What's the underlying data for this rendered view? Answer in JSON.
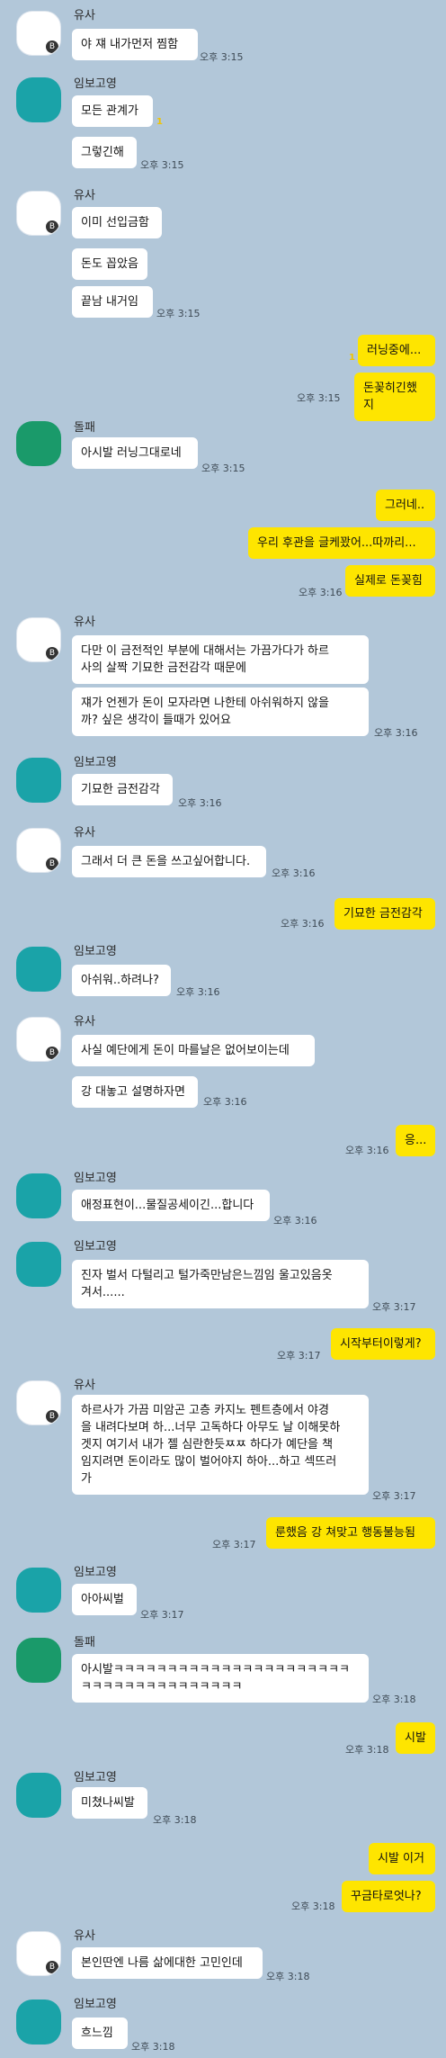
{
  "names": {
    "yusa": "유사",
    "boyoung": "임보고영",
    "dolpae": "돌패"
  },
  "messages": [
    {
      "text": "야 쟤 내가먼저 찜함",
      "time": "오후 3:15"
    },
    {
      "text": "모든 관계가",
      "time": ""
    },
    {
      "text": "그렇긴해",
      "time": "오후 3:15"
    },
    {
      "text": "이미 선입금함",
      "time": ""
    },
    {
      "text": "돈도 꼽았음",
      "time": ""
    },
    {
      "text": "끝남 내거임",
      "time": "오후 3:15"
    },
    {
      "text": "러닝중에...",
      "time": ""
    },
    {
      "text": "돈꽂히긴했지",
      "time": "오후 3:15"
    },
    {
      "text": "아시발 러닝그대로네",
      "time": "오후 3:15"
    },
    {
      "text": "그러네..",
      "time": ""
    },
    {
      "text": "우리 후관을 글케꽜어...따까리...",
      "time": ""
    },
    {
      "text": "실제로 돈꽂힘",
      "time": "오후 3:16"
    },
    {
      "text": "다만 이 금전적인 부분에 대해서는 가끔가다가 하르\n사의 살짝 기묘한 금전감각 때문에",
      "time": ""
    },
    {
      "text": "쟤가 언젠가 돈이 모자라면 나한테 아쉬워하지 않을\n까? 싶은 생각이 들때가 있어요",
      "time": "오후 3:16"
    },
    {
      "text": "기묘한 금전감각",
      "time": "오후 3:16"
    },
    {
      "text": "그래서 더 큰 돈을 쓰고싶어합니다.",
      "time": "오후 3:16"
    },
    {
      "text": "기묘한 금전감각",
      "time": "오후 3:16"
    },
    {
      "text": "아쉬워..하려나?",
      "time": "오후 3:16"
    },
    {
      "text": "사실 예단에게 돈이 마를날은 없어보이는데",
      "time": ""
    },
    {
      "text": "강 대놓고 설명하자면",
      "time": "오후 3:16"
    },
    {
      "text": "응...",
      "time": "오후 3:16"
    },
    {
      "text": "애정표현이...물질공세이긴...합니다",
      "time": "오후 3:16"
    },
    {
      "text": "진자 벌서 다털리고 털가죽만남은느낌임 울고있음옷\n겨서......",
      "time": "오후 3:17"
    },
    {
      "text": "시작부터이렇게?",
      "time": "오후 3:17"
    },
    {
      "text": "하르사가 가끔 미암곤 고층 카지노 펜트층에서 야경\n을 내려다보며 하...너무 고독하다 아무도 날 이해못하\n겟지 여기서 내가 젤 심란한듯ㅉㅉ 하다가 예단을 책\n임지려면 돈이라도 많이 벌어야지 하아...하고 섹뜨러\n가",
      "time": "오후 3:17"
    },
    {
      "text": "룬했음 강 쳐맞고 행동불능됨",
      "time": "오후 3:17"
    },
    {
      "text": "아아씨벌",
      "time": "오후 3:17"
    },
    {
      "text": "아시발ㅋㅋㅋㅋㅋㅋㅋㅋㅋㅋㅋㅋㅋㅋㅋㅋㅋㅋㅋㅋㅋㅋ\nㅋㅋㅋㅋㅋㅋㅋㅋㅋㅋㅋㅋㅋㅋㅋ",
      "time": "오후 3:18"
    },
    {
      "text": "시발",
      "time": "오후 3:18"
    },
    {
      "text": "미쳤나씨발",
      "time": "오후 3:18"
    },
    {
      "text": "시발 이거",
      "time": ""
    },
    {
      "text": "꾸금타로엇나?",
      "time": "오후 3:18"
    },
    {
      "text": "본인딴엔 나름 삶에대한 고민인데",
      "time": "오후 3:18"
    },
    {
      "text": "흐느낌",
      "time": "오후 3:18"
    }
  ],
  "colors": {
    "background": "#b2c7d9",
    "mine": "#fee500",
    "theirs": "#ffffff"
  }
}
